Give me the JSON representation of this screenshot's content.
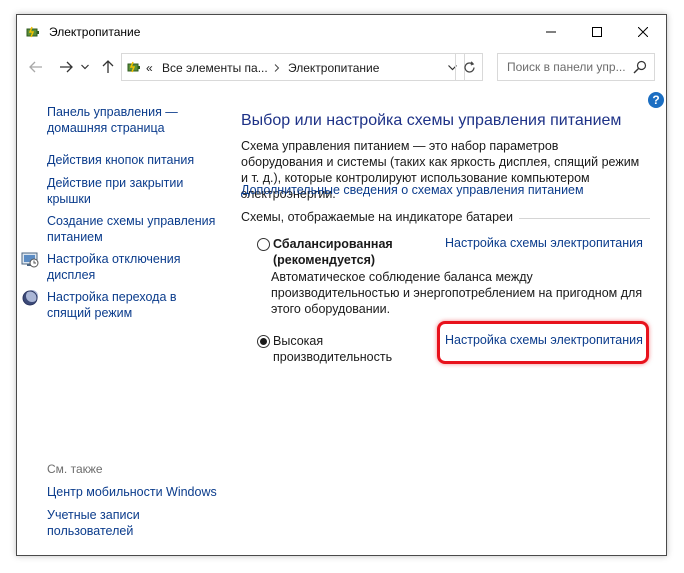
{
  "window": {
    "title": "Электропитание",
    "controls": {
      "minimize": "minimize",
      "maximize": "maximize",
      "close": "close"
    }
  },
  "nav": {
    "back_icon": "back-arrow-icon",
    "forward_icon": "forward-arrow-icon",
    "recent_icon": "chevron-down-icon",
    "up_icon": "up-arrow-icon",
    "address": {
      "overflow": "«",
      "segments": [
        "Все элементы па...",
        "Электропитание"
      ]
    },
    "search": {
      "placeholder": "Поиск в панели упр..."
    }
  },
  "sidebar": {
    "home_link": "Панель управления — домашняя страница",
    "items": [
      {
        "label": "Действия кнопок питания"
      },
      {
        "label": "Действие при закрытии крышки"
      },
      {
        "label": "Создание схемы управления питанием"
      },
      {
        "label": "Настройка отключения дисплея",
        "icon": "display-icon"
      },
      {
        "label": "Настройка перехода в спящий режим",
        "icon": "moon-icon"
      }
    ],
    "see_also": {
      "title": "См. также",
      "items": [
        {
          "label": "Центр мобильности Windows"
        },
        {
          "label": "Учетные записи пользователей"
        }
      ]
    }
  },
  "main": {
    "heading": "Выбор или настройка схемы управления питанием",
    "description": "Схема управления питанием — это набор параметров оборудования и системы (таких как яркость дисплея, спящий режим и т. д.), которые контролируют использование компьютером электроэнергии.",
    "more_link": "Дополнительные сведения о схемах управления питанием",
    "group_label": "Схемы, отображаемые на индикаторе батареи",
    "plans": [
      {
        "name": "Сбалансированная (рекомендуется)",
        "selected": false,
        "link": "Настройка схемы электропитания",
        "description": "Автоматическое соблюдение баланса между производительностью и энергопотреблением на пригодном для этого оборудовании."
      },
      {
        "name": "Высокая производительность",
        "selected": true,
        "link": "Настройка схемы электропитания"
      }
    ],
    "help_label": "?"
  },
  "colors": {
    "link": "#0b3c8c",
    "heading": "#1e3287",
    "highlight": "#e8121c",
    "help": "#1b6ec2"
  }
}
